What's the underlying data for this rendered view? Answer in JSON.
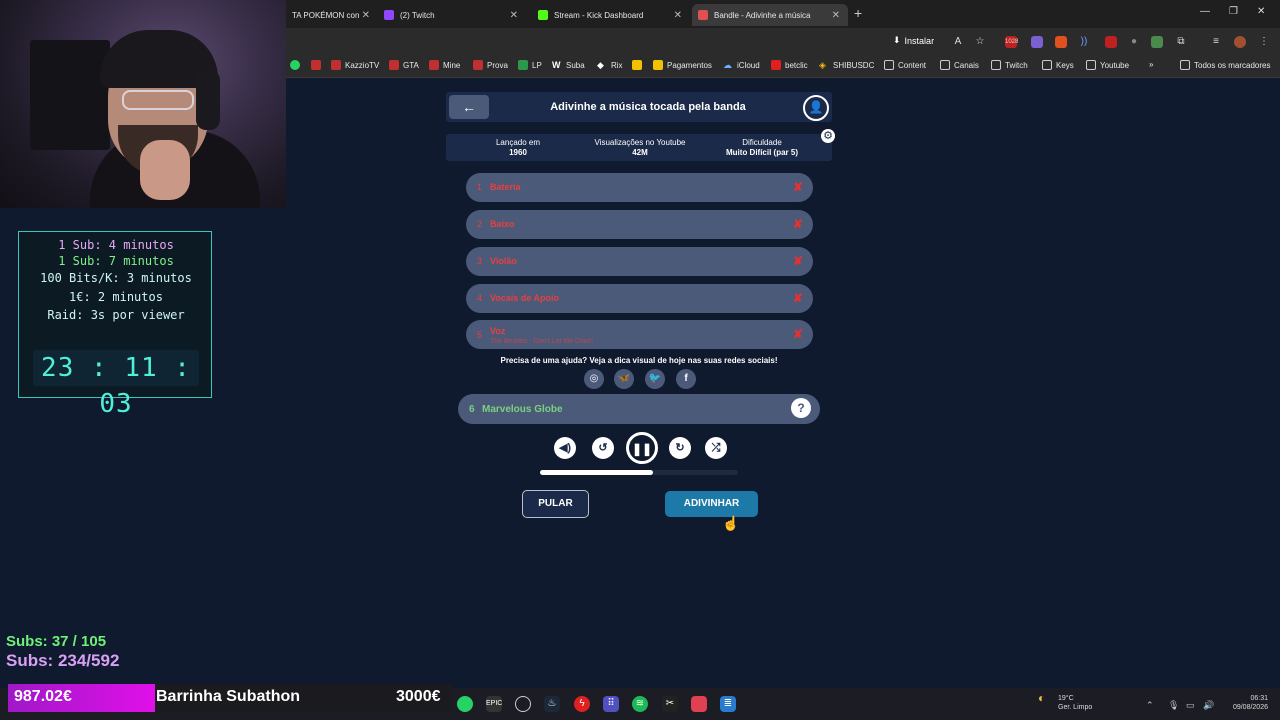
{
  "browser": {
    "tabs": [
      {
        "label": "TA POKÉMON con",
        "active": false
      },
      {
        "label": "(2) Twitch",
        "active": false
      },
      {
        "label": "Stream - Kick Dashboard",
        "active": false
      },
      {
        "label": "Bandle - Adivinhe a música",
        "active": true
      }
    ],
    "install_label": "Instalar",
    "bookmarks": [
      "KazzioTV",
      "GTA",
      "Mine",
      "Prova",
      "LP",
      "Suba",
      "Rix",
      "Pagamentos",
      "iCloud",
      "betclic",
      "SHIBUSDC",
      "Content",
      "Canais",
      "Twitch",
      "Keys",
      "Youtube"
    ],
    "all_bookmarks": "Todos os marcadores",
    "more": "»"
  },
  "overlay": {
    "timer_lines": [
      {
        "text": "1 Sub: 4 minutos",
        "color": "#e9a6f7"
      },
      {
        "text": "1 Sub: 7 minutos",
        "color": "#7ff08a"
      },
      {
        "text": "100 Bits/K: 3 minutos",
        "color": "#d0f5f0"
      },
      {
        "text": "1€: 2 minutos",
        "color": "#d0f5f0"
      },
      {
        "text": "Raid: 3s por viewer",
        "color": "#d0f5f0"
      }
    ],
    "countdown": "23 : 11 : 03",
    "subs1": "Subs: 37 / 105",
    "subs2": "Subs: 234/592",
    "bar_left": "987.02€",
    "bar_title": "Barrinha Subathon",
    "bar_right": "3000€",
    "bar_progress": 0.33
  },
  "game": {
    "title": "Adivinhe a música tocada pela banda",
    "back_icon": "←",
    "info": [
      {
        "label": "Lançado em",
        "value": "1960"
      },
      {
        "label": "Visualizações no Youtube",
        "value": "42M"
      },
      {
        "label": "Dificuldade",
        "value": "Muito Difícil (par 5)"
      }
    ],
    "rows": [
      {
        "num": "1",
        "label": "Bateria",
        "sub": ""
      },
      {
        "num": "2",
        "label": "Baixo",
        "sub": ""
      },
      {
        "num": "3",
        "label": "Violão",
        "sub": ""
      },
      {
        "num": "4",
        "label": "Vocais de Apoio",
        "sub": ""
      },
      {
        "num": "5",
        "label": "Voz",
        "sub": "The Beatles - Don't Let Me Down"
      }
    ],
    "wrong_mark": "✘",
    "help_text": "Precisa de uma ajuda? Veja a dica visual de hoje nas suas redes sociais!",
    "guess": {
      "num": "6",
      "text": "Marvelous Globe"
    },
    "progress": 0.57,
    "skip_label": "PULAR",
    "guess_label": "ADIVINHAR"
  },
  "system": {
    "weather_temp": "19°C",
    "weather_desc": "Ger. Limpo",
    "time": "06:31",
    "date": "09/08/2026"
  }
}
